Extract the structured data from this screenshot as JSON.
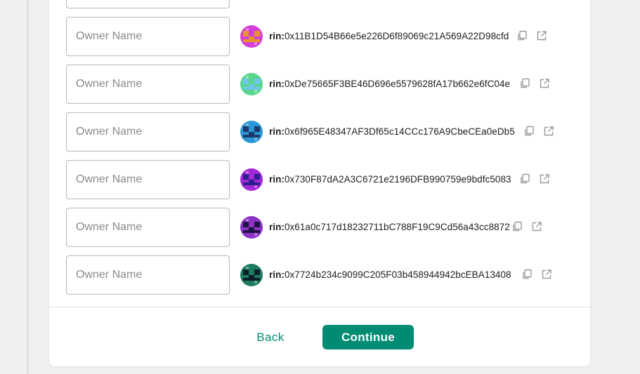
{
  "owners": {
    "input_placeholder": "Owner Name",
    "network_prefix": "rin:",
    "rows": [
      {
        "address": "0x11B1D54B66e5e226D6f89069c21A569A22D98cfd",
        "avatar": {
          "bg": "#d43fd8",
          "fg": "#e7932c"
        }
      },
      {
        "address": "0xDe75665F3BE46D696e5579628fA17b662e6fC04e",
        "avatar": {
          "bg": "#58d68d",
          "fg": "#6ec6ee"
        }
      },
      {
        "address": "0x6f965E48347AF3Df65c14CCc176A9CbeCEa0eDb5",
        "avatar": {
          "bg": "#2a96d6",
          "fg": "#1b3a6b"
        }
      },
      {
        "address": "0x730F87dA2A3C6721e2196DFB990759e9bdfc5083",
        "avatar": {
          "bg": "#a328d6",
          "fg": "#2a1f8c"
        }
      },
      {
        "address": "0x61a0c717d18232711bC788F19C9Cd56a43cc8872",
        "avatar": {
          "bg": "#8a33c4",
          "fg": "#1f1346"
        }
      },
      {
        "address": "0x7724b234c9099C205F03b458944942bcEBA13408",
        "avatar": {
          "bg": "#1c7d5f",
          "fg": "#0b1f2a"
        }
      }
    ]
  },
  "actions": {
    "back_label": "Back",
    "continue_label": "Continue"
  },
  "colors": {
    "accent": "#008c73",
    "icon": "#9a9a9a"
  }
}
